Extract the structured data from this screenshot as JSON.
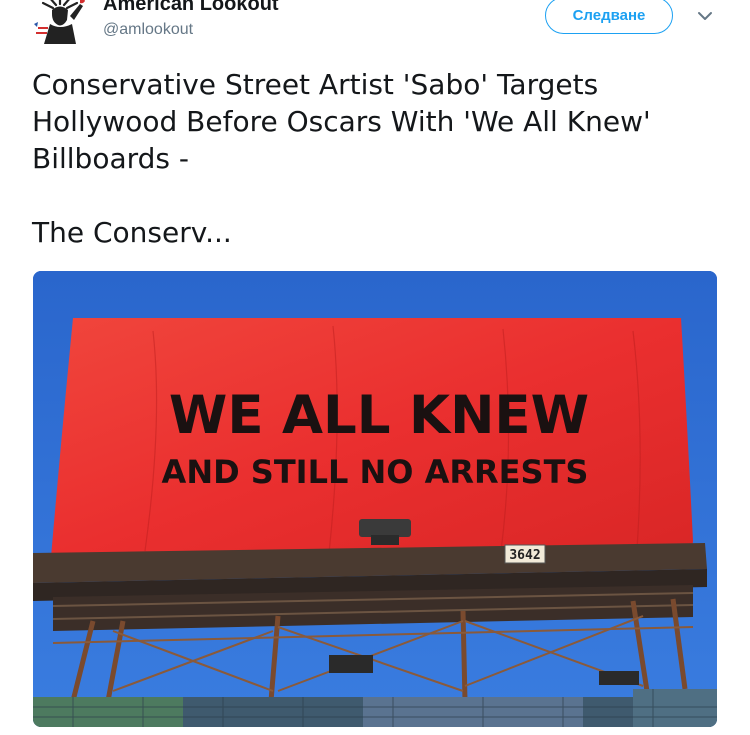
{
  "account": {
    "display_name": "American Lookout",
    "handle": "@amlookout",
    "avatar_icon": "statue-of-liberty-logo"
  },
  "follow_button": {
    "label": "Следване"
  },
  "menu": {
    "icon": "chevron-down-icon"
  },
  "tweet": {
    "lines": [
      "Conservative Street Artist 'Sabo' Targets",
      "Hollywood Before Oscars With 'We All Knew'",
      "Billboards -",
      "The Conserv..."
    ]
  },
  "media": {
    "billboard_headline": "WE ALL KNEW",
    "billboard_subline": "AND STILL NO ARRESTS",
    "billboard_number": "3642"
  },
  "colors": {
    "accent": "#1da1f2",
    "secondary_text": "#657786",
    "billboard_red": "#ea2f2f",
    "sky_blue": "#2e6fd2"
  }
}
